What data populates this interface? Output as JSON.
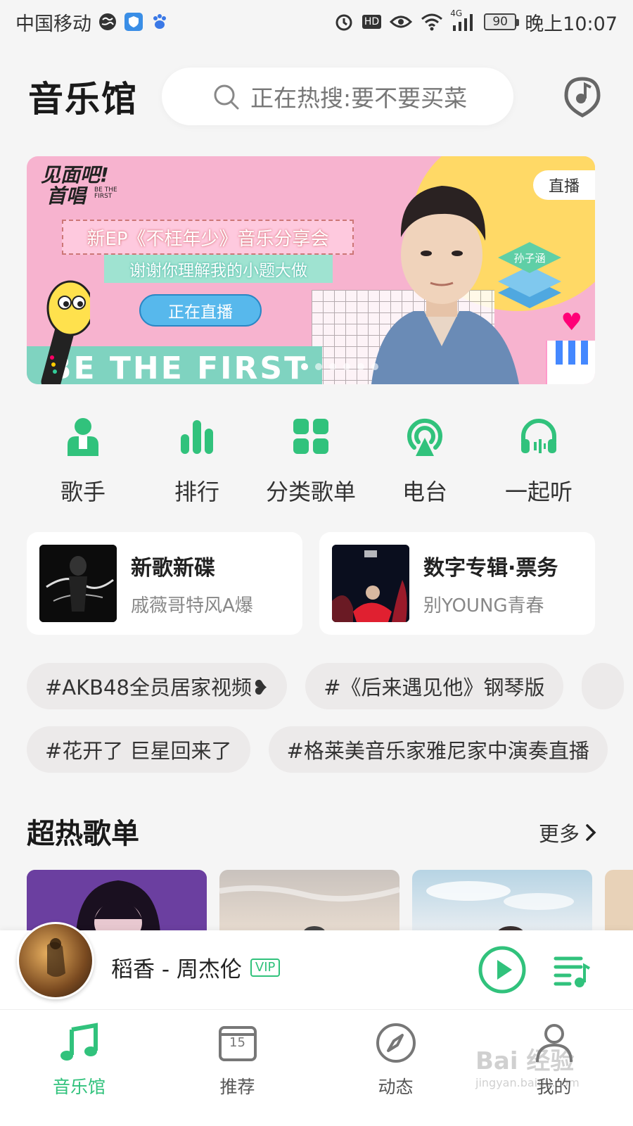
{
  "status_bar": {
    "carrier": "中国移动",
    "time": "晚上10:07",
    "battery": "90",
    "network": "4G",
    "hd": "HD"
  },
  "header": {
    "title": "音乐馆",
    "search_placeholder": "正在热搜:要不要买菜"
  },
  "banner": {
    "logo_line1": "见面吧!",
    "logo_line2": "首唱",
    "logo_sub": "BE THE FIRST",
    "ep_title": "新EP《不枉年少》音乐分享会",
    "ep_subtitle": "谢谢你理解我的小题大做",
    "live_button": "正在直播",
    "badge": "直播",
    "tagline": "BE THE FIRST",
    "artist_tag": "孙子涵"
  },
  "quick_nav": [
    {
      "label": "歌手",
      "icon": "singer-icon"
    },
    {
      "label": "排行",
      "icon": "chart-icon"
    },
    {
      "label": "分类歌单",
      "icon": "grid-icon"
    },
    {
      "label": "电台",
      "icon": "radio-icon"
    },
    {
      "label": "一起听",
      "icon": "headphones-icon"
    }
  ],
  "cards": [
    {
      "title": "新歌新碟",
      "subtitle": "戚薇哥特风A爆"
    },
    {
      "title": "数字专辑·票务",
      "subtitle": "别YOUNG青春"
    }
  ],
  "tags_row1": [
    "#AKB48全员居家视频❥",
    "#《后来遇见他》钢琴版"
  ],
  "tags_row2": [
    "#花开了 巨星回来了",
    "#格莱美音乐家雅尼家中演奏直播"
  ],
  "section": {
    "title": "超热歌单",
    "more": "更多"
  },
  "player": {
    "song": "稻香 - 周杰伦",
    "vip": "VIP"
  },
  "tabs": [
    {
      "label": "音乐馆",
      "icon": "music-note-icon",
      "active": true
    },
    {
      "label": "推荐",
      "icon": "calendar-icon",
      "calendar_day": "15"
    },
    {
      "label": "动态",
      "icon": "compass-icon"
    },
    {
      "label": "我的",
      "icon": "profile-icon"
    }
  ],
  "watermark": {
    "text": "Bai 经验",
    "sub": "jingyan.baidu.com"
  },
  "colors": {
    "accent": "#31c27c",
    "background": "#f5f5f5"
  }
}
